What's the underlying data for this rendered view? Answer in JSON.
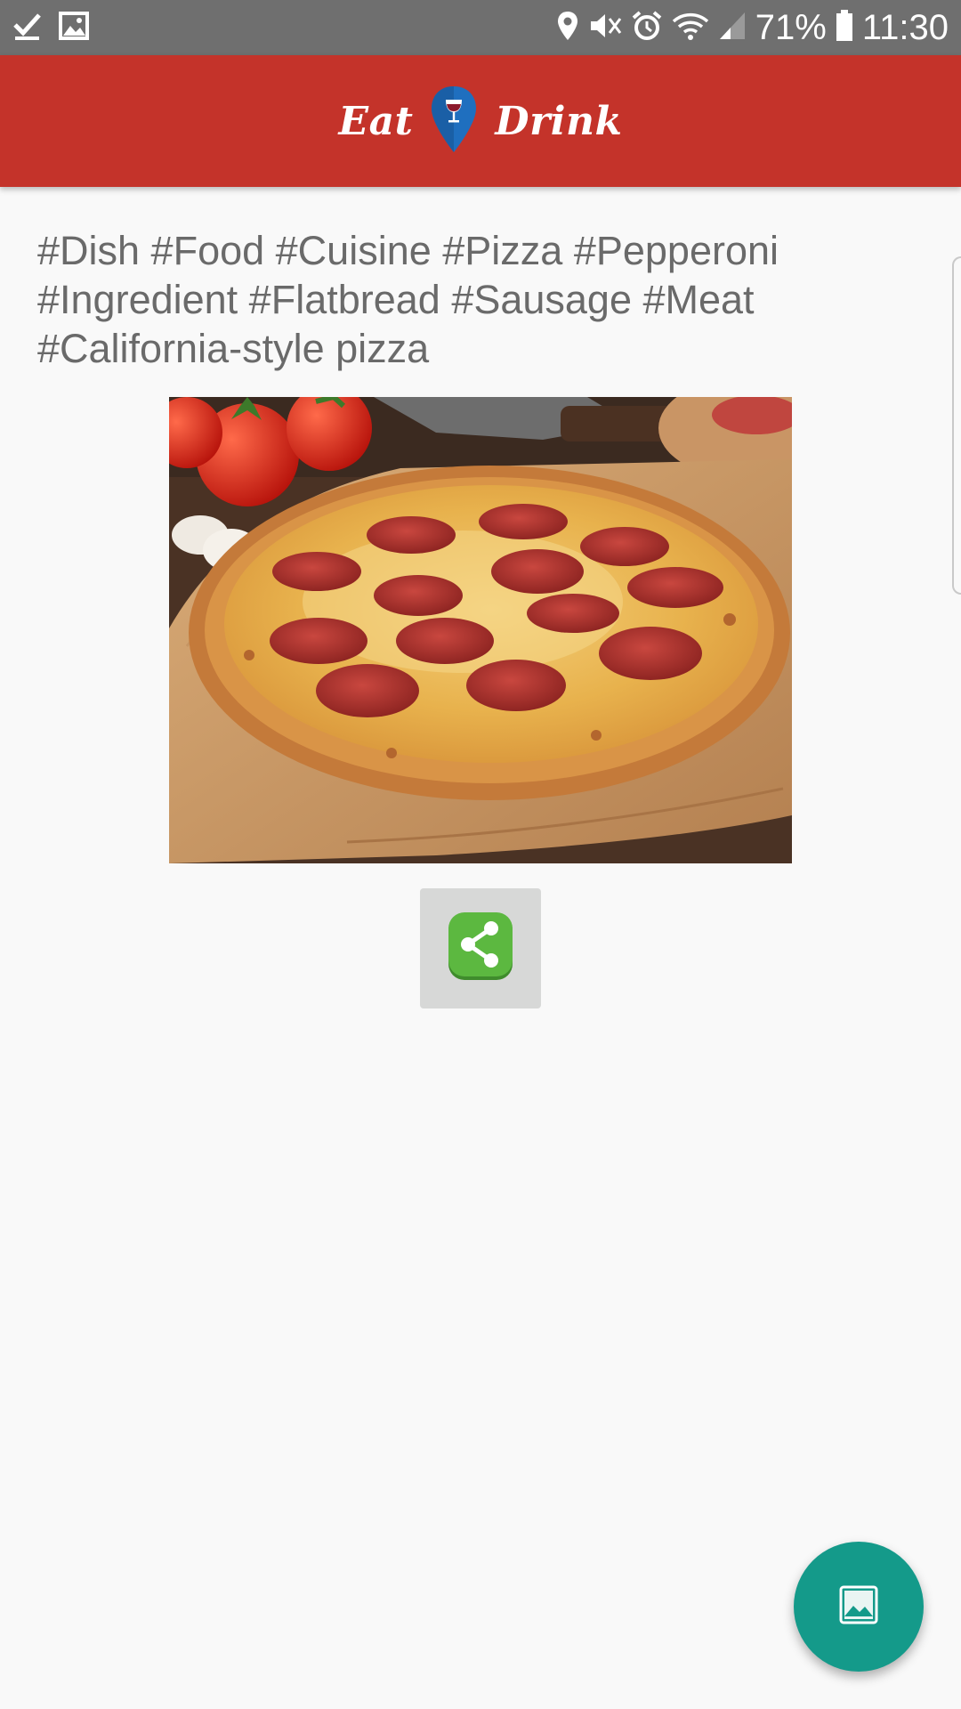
{
  "status_bar": {
    "icons_left": [
      "check-icon",
      "image-icon"
    ],
    "icons_right": [
      "location-icon",
      "mute-icon",
      "alarm-icon",
      "wifi-icon",
      "signal-icon",
      "battery-icon"
    ],
    "battery": "71%",
    "time": "11:30"
  },
  "app_bar": {
    "logo_left": "Eat",
    "logo_right": "Drink",
    "logo_icon": "map-pin-wine-icon",
    "background_color": "#c4332a"
  },
  "content": {
    "tags": "#Dish #Food #Cuisine #Pizza #Pepperoni #Ingredient #Flatbread #Sausage #Meat #California-style pizza",
    "photo_subject": "pepperoni-pizza-photo"
  },
  "actions": {
    "share_icon": "share-icon",
    "share_color": "#5cb840",
    "fab_icon": "gallery-icon",
    "fab_color": "#149a8a"
  }
}
